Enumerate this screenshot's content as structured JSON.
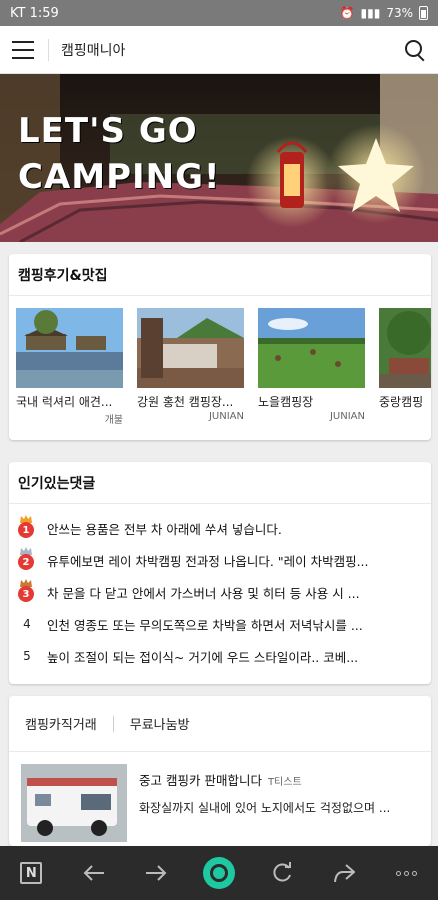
{
  "status_bar": {
    "carrier": "KT 1:59",
    "battery": "73%",
    "icons": [
      "alarm-icon",
      "mute-icon",
      "lte-icon",
      "signal-icon",
      "battery-icon"
    ]
  },
  "header": {
    "menu_icon": "hamburger-icon",
    "title": "캠핑매니아",
    "search_icon": "search-icon"
  },
  "hero": {
    "headline_line1": "LET'S GO",
    "headline_line2": "CAMPING!"
  },
  "reviews": {
    "title": "캠핑후기&맛집",
    "items": [
      {
        "caption": "국내 럭셔리 애견...",
        "author": "개불"
      },
      {
        "caption": "강원 홍천 캠핑장...",
        "author": "JUNIAN"
      },
      {
        "caption": "노을캠핑장",
        "author": "JUNIAN"
      },
      {
        "caption": "중랑캠핑",
        "author": ""
      }
    ]
  },
  "popular": {
    "title": "인기있는댓글",
    "items": [
      {
        "rank": "1",
        "text": "안쓰는 용품은 전부 차 아래에 쑤셔 넣습니다."
      },
      {
        "rank": "2",
        "text": "유투에보면 레이 차박캠핑 전과정 나옵니다. \"레이 차박캠핑..."
      },
      {
        "rank": "3",
        "text": "차 문을 다 닫고 안에서 가스버너 사용 및 히터 등 사용 시 ..."
      },
      {
        "rank": "4",
        "text": "인천 영종도 또는 무의도쪽으로 차박을 하면서 저녁낚시를 ..."
      },
      {
        "rank": "5",
        "text": "높이 조절이 되는 접이식~ 거기에 우드 스타일이라.. 코베..."
      }
    ]
  },
  "market": {
    "tabs": [
      "캠핑카직거래",
      "무료나눔방"
    ],
    "item": {
      "title": "중고 캠핑카 판매합니다",
      "author": "T티스트",
      "desc": "화장실까지 실내에 있어 노지에서도 걱정없으며 ..."
    }
  },
  "bottom_nav": [
    "naver-n-icon",
    "back-arrow-icon",
    "forward-arrow-icon",
    "green-dot-icon",
    "refresh-icon",
    "share-icon",
    "more-icon"
  ]
}
